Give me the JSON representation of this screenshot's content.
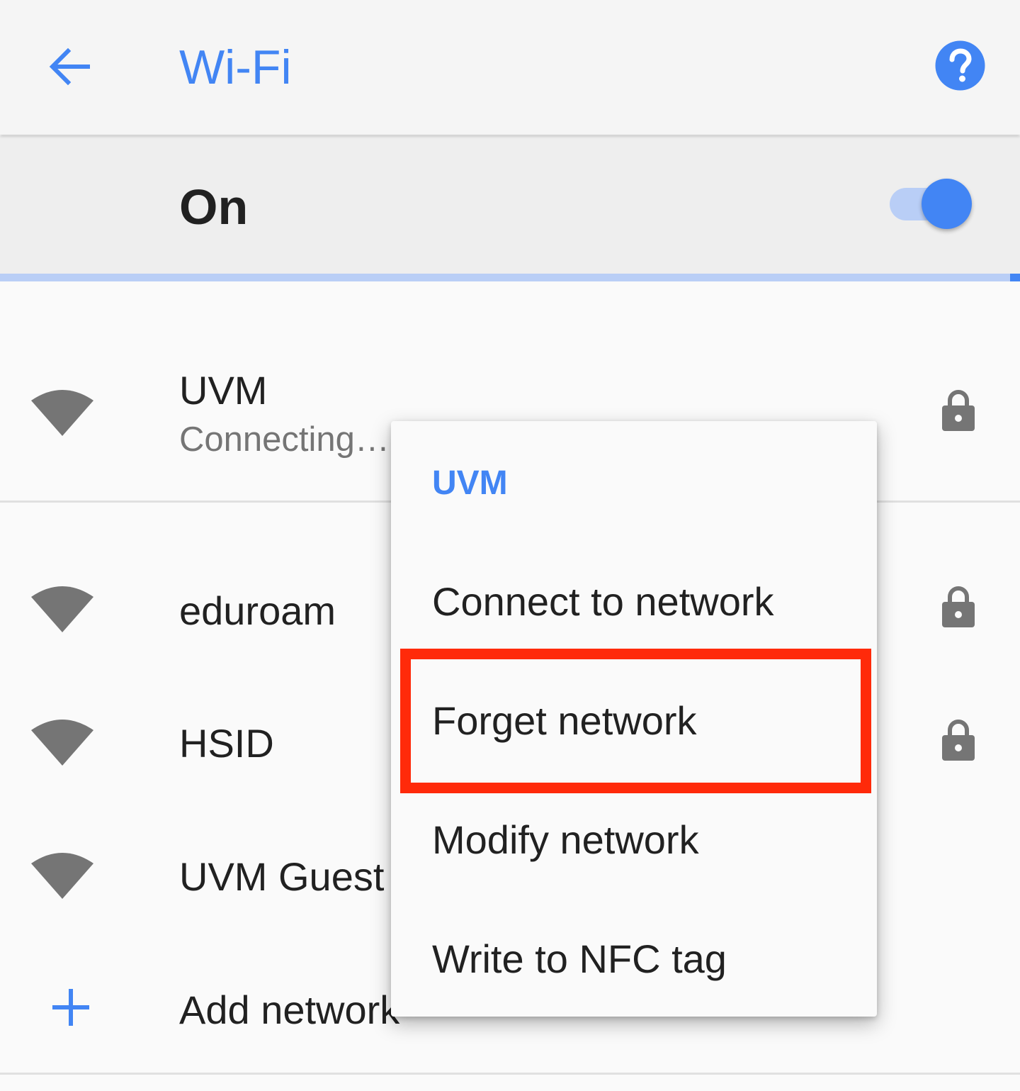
{
  "appbar": {
    "title": "Wi-Fi",
    "back_icon": "arrow-back-icon",
    "help_icon": "help-icon"
  },
  "master_switch": {
    "label": "On",
    "checked": true
  },
  "networks": [
    {
      "name": "UVM",
      "status": "Connecting…",
      "secured": true
    },
    {
      "name": "eduroam",
      "status": "",
      "secured": true
    },
    {
      "name": "HSID",
      "status": "",
      "secured": true
    },
    {
      "name": "UVM Guest",
      "status": "",
      "secured": false
    }
  ],
  "add_network": {
    "label": "Add network",
    "icon": "plus-icon"
  },
  "context_menu": {
    "title": "UVM",
    "items": [
      {
        "label": "Connect to network"
      },
      {
        "label": "Forget network",
        "highlighted": true
      },
      {
        "label": "Modify network"
      },
      {
        "label": "Write to NFC tag"
      }
    ]
  },
  "colors": {
    "accent": "#4285f4",
    "accent_light": "#b9cef6",
    "highlight_box": "#ff2a0a",
    "icon_gray": "#757575",
    "text_primary": "#212121"
  }
}
